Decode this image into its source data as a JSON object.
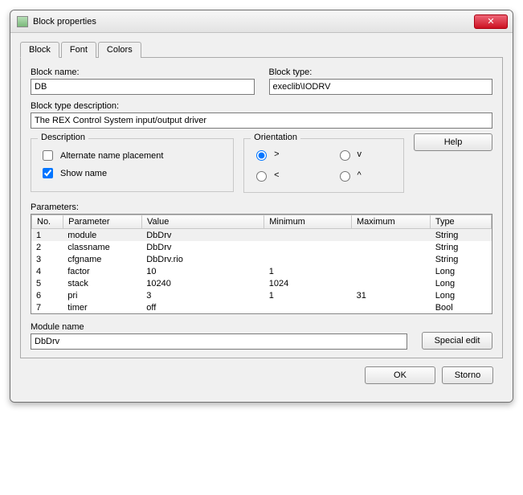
{
  "window": {
    "title": "Block properties"
  },
  "tabs": {
    "block": "Block",
    "font": "Font",
    "colors": "Colors"
  },
  "fields": {
    "block_name_label": "Block name:",
    "block_name_value": "DB",
    "block_type_label": "Block type:",
    "block_type_value": "execlib\\IODRV",
    "block_type_desc_label": "Block type description:",
    "block_type_desc_value": "The REX Control System input/output driver"
  },
  "description": {
    "legend": "Description",
    "alternate_label": "Alternate name placement",
    "alternate_checked": false,
    "show_name_label": "Show name",
    "show_name_checked": true
  },
  "orientation": {
    "legend": "Orientation",
    "gt": ">",
    "lt": "<",
    "v": "v",
    "caret": "^",
    "selected": "gt"
  },
  "buttons": {
    "help": "Help",
    "special_edit": "Special edit",
    "ok": "OK",
    "storno": "Storno"
  },
  "parameters": {
    "label": "Parameters:",
    "headers": {
      "no": "No.",
      "parameter": "Parameter",
      "value": "Value",
      "minimum": "Minimum",
      "maximum": "Maximum",
      "type": "Type"
    },
    "rows": [
      {
        "no": "1",
        "parameter": "module",
        "value": "DbDrv",
        "minimum": "",
        "maximum": "",
        "type": "String"
      },
      {
        "no": "2",
        "parameter": "classname",
        "value": "DbDrv",
        "minimum": "",
        "maximum": "",
        "type": "String"
      },
      {
        "no": "3",
        "parameter": "cfgname",
        "value": "DbDrv.rio",
        "minimum": "",
        "maximum": "",
        "type": "String"
      },
      {
        "no": "4",
        "parameter": "factor",
        "value": "10",
        "minimum": "1",
        "maximum": "",
        "type": "Long"
      },
      {
        "no": "5",
        "parameter": "stack",
        "value": "10240",
        "minimum": "1024",
        "maximum": "",
        "type": "Long"
      },
      {
        "no": "6",
        "parameter": "pri",
        "value": "3",
        "minimum": "1",
        "maximum": "31",
        "type": "Long"
      },
      {
        "no": "7",
        "parameter": "timer",
        "value": "off",
        "minimum": "",
        "maximum": "",
        "type": "Bool"
      }
    ]
  },
  "module_name": {
    "label": "Module name",
    "value": "DbDrv"
  }
}
